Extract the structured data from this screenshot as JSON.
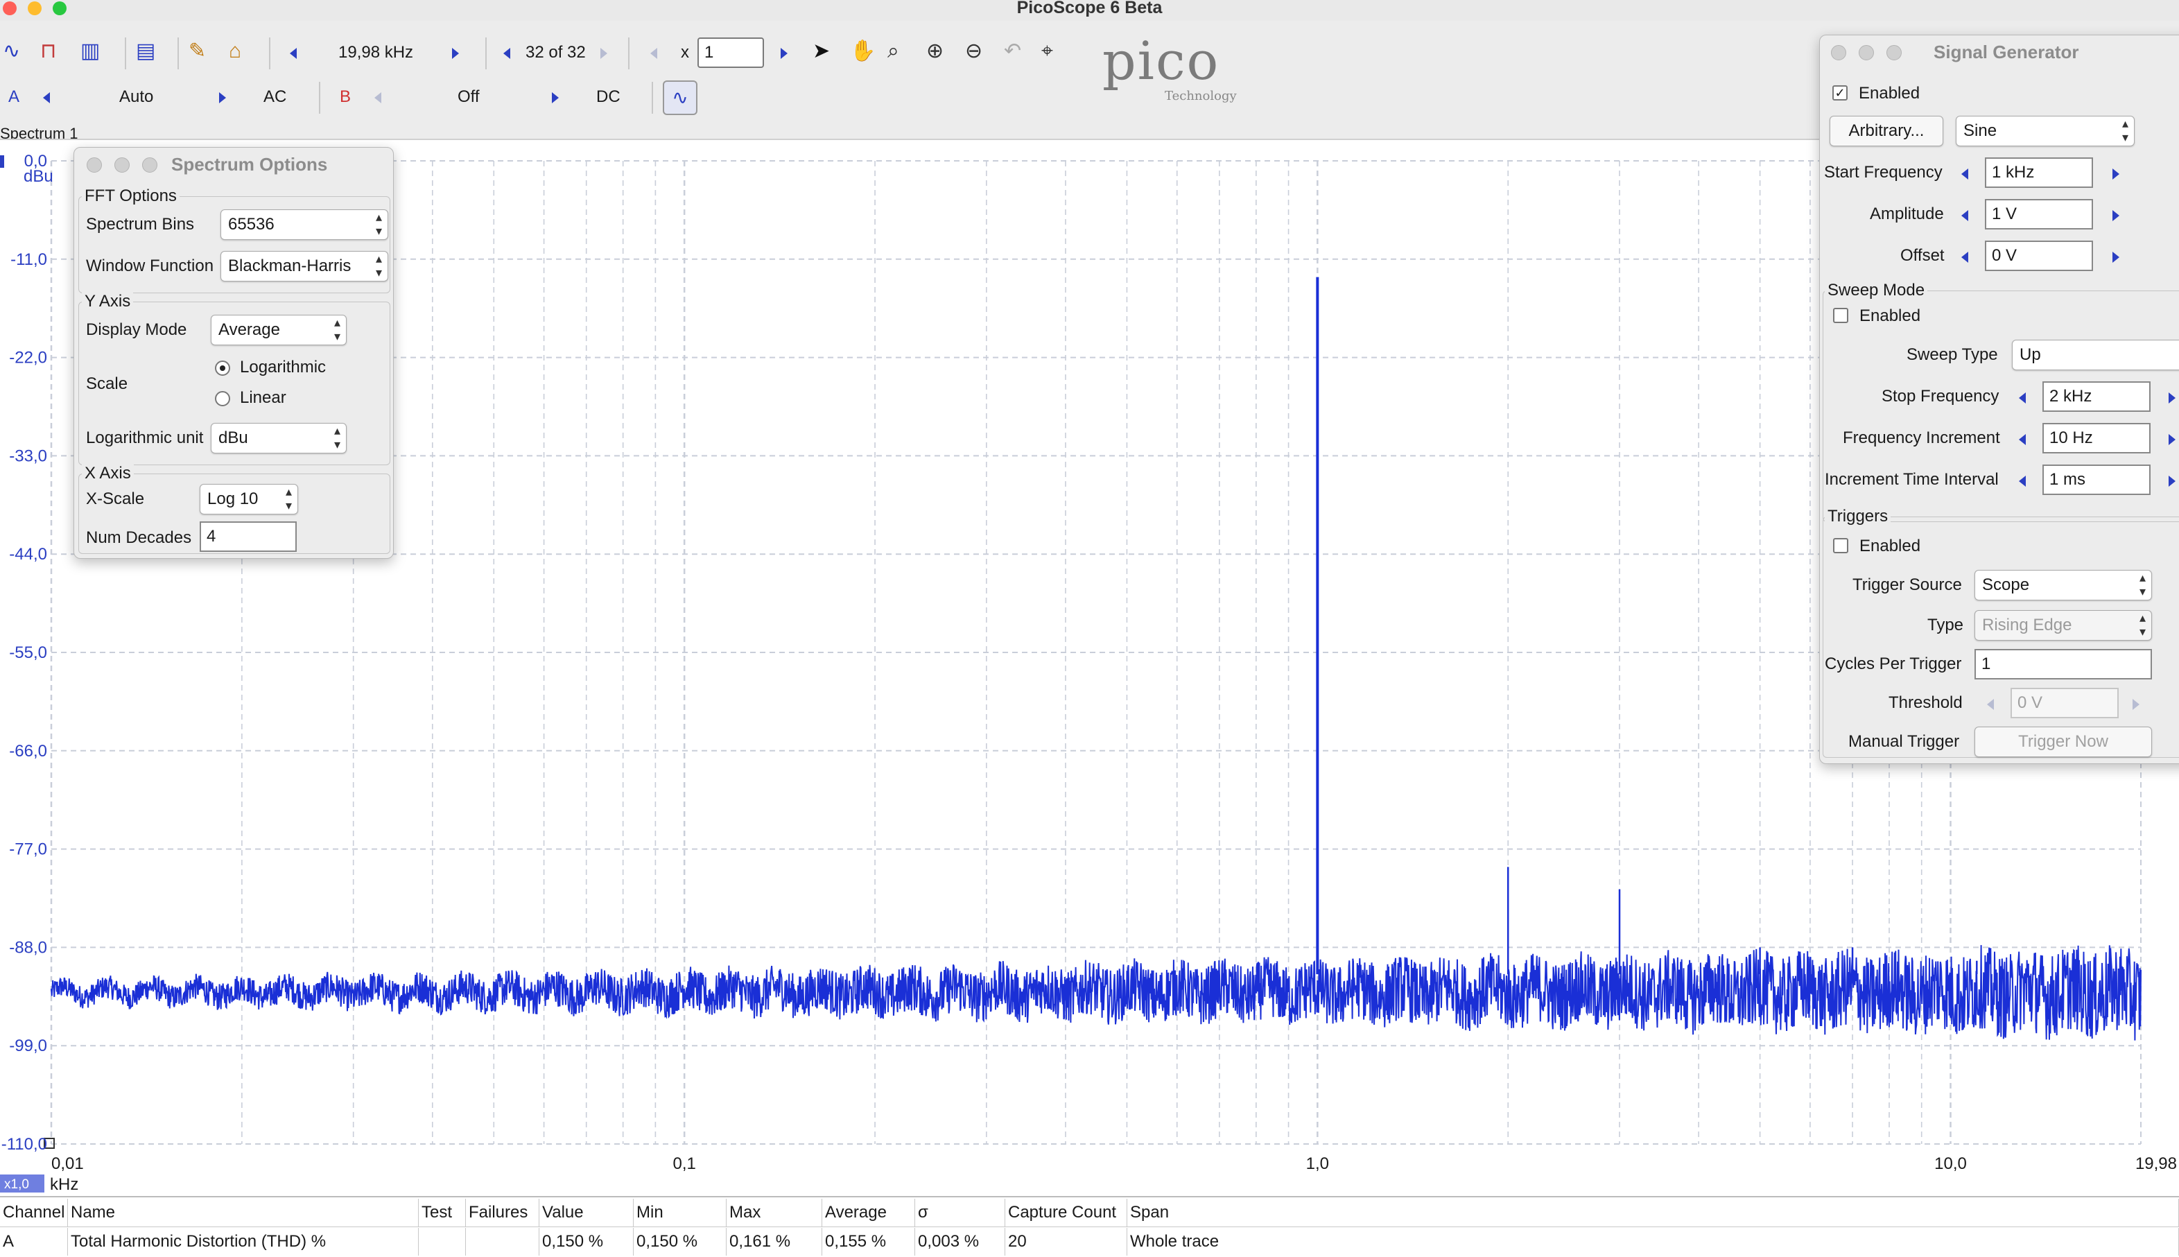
{
  "window": {
    "title": "PicoScope 6 Beta"
  },
  "toolbar": {
    "timebase": "19,98 kHz",
    "buffer": "32 of 32",
    "zoom_prefix": "x",
    "zoom_value": "1",
    "channel_a": {
      "label": "A",
      "range": "Auto",
      "coupling": "AC"
    },
    "channel_b": {
      "label": "B",
      "range": "Off",
      "coupling": "DC"
    }
  },
  "logo": {
    "word": "pico",
    "sub": "Technology"
  },
  "plot": {
    "tab_label": "Spectrum 1",
    "y_unit": "dBu",
    "x_unit": "kHz",
    "x_zoom_badge": "x1,0"
  },
  "chart_data": {
    "type": "line",
    "xscale": "log",
    "xlim": [
      0.01,
      19.98
    ],
    "ylim": [
      -110,
      0
    ],
    "y_ticks": [
      "0,0",
      "-11,0",
      "-22,0",
      "-33,0",
      "-44,0",
      "-55,0",
      "-66,0",
      "-77,0",
      "-88,0",
      "-99,0",
      "-110,0"
    ],
    "x_ticks": [
      "0,01",
      "0,1",
      "1,0",
      "10,0",
      "19,98"
    ],
    "grid": true,
    "noise_floor_db": -93,
    "peaks": [
      {
        "x": 1.0,
        "y": -13.0
      },
      {
        "x": 2.0,
        "y": -79.0
      },
      {
        "x": 3.0,
        "y": -81.5
      },
      {
        "x": 5.0,
        "y": -88.0
      },
      {
        "x": 7.0,
        "y": -88.0
      },
      {
        "x": 11.0,
        "y": -89.5
      }
    ]
  },
  "spectrum_options": {
    "title": "Spectrum Options",
    "fft_group": "FFT Options",
    "bins_label": "Spectrum Bins",
    "bins_value": "65536",
    "window_label": "Window Function",
    "window_value": "Blackman-Harris",
    "yaxis_group": "Y Axis",
    "display_mode_label": "Display Mode",
    "display_mode_value": "Average",
    "scale_label": "Scale",
    "scale_log": "Logarithmic",
    "scale_lin": "Linear",
    "log_unit_label": "Logarithmic unit",
    "log_unit_value": "dBu",
    "xaxis_group": "X Axis",
    "xscale_label": "X-Scale",
    "xscale_value": "Log 10",
    "decades_label": "Num Decades",
    "decades_value": "4"
  },
  "signal_generator": {
    "title": "Signal Generator",
    "enabled_label": "Enabled",
    "arbitrary_button": "Arbitrary...",
    "waveform": "Sine",
    "start_freq_label": "Start Frequency",
    "start_freq": "1 kHz",
    "amplitude_label": "Amplitude",
    "amplitude": "1 V",
    "offset_label": "Offset",
    "offset": "0 V",
    "sweep_group": "Sweep Mode",
    "sweep_enabled_label": "Enabled",
    "sweep_type_label": "Sweep Type",
    "sweep_type": "Up",
    "stop_freq_label": "Stop Frequency",
    "stop_freq": "2 kHz",
    "freq_inc_label": "Frequency Increment",
    "freq_inc": "10 Hz",
    "inc_time_label": "Increment Time Interval",
    "inc_time": "1 ms",
    "triggers_group": "Triggers",
    "trig_enabled_label": "Enabled",
    "trig_source_label": "Trigger Source",
    "trig_source": "Scope",
    "type_label": "Type",
    "type_value": "Rising Edge",
    "cycles_label": "Cycles Per Trigger",
    "cycles_value": "1",
    "threshold_label": "Threshold",
    "threshold_value": "0 V",
    "manual_label": "Manual Trigger",
    "trigger_now": "Trigger Now"
  },
  "measurements": {
    "headers": [
      "Channel",
      "Name",
      "Test",
      "Failures",
      "Value",
      "Min",
      "Max",
      "Average",
      "σ",
      "Capture Count",
      "Span"
    ],
    "rows": [
      [
        "A",
        "Total Harmonic Distortion (THD) %",
        "",
        "",
        "0,150 %",
        "0,150 %",
        "0,161 %",
        "0,155 %",
        "0,003 %",
        "20",
        "Whole trace"
      ]
    ]
  },
  "colors": {
    "trace": "#1a2fd6",
    "axis_text": "#2b3fc2",
    "grid": "#c9ced9"
  }
}
